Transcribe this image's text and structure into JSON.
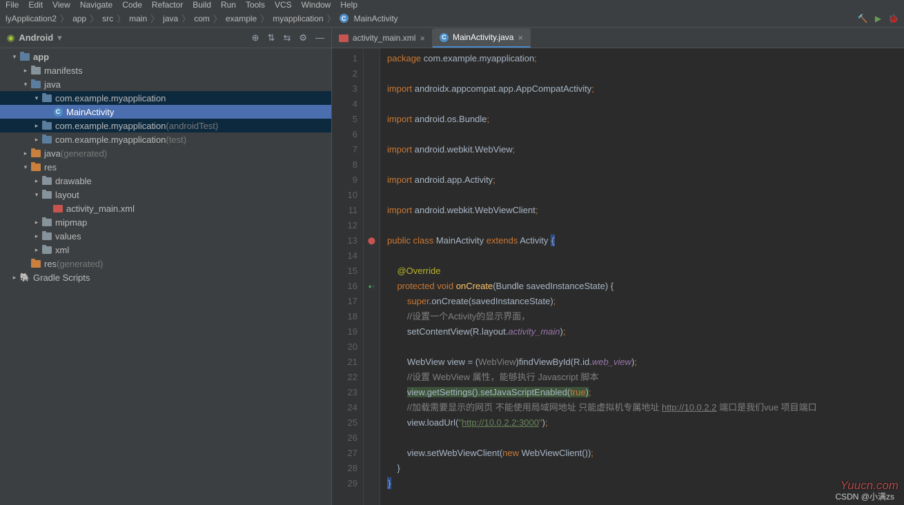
{
  "menubar": [
    "File",
    "Edit",
    "View",
    "Navigate",
    "Code",
    "Refactor",
    "Build",
    "Run",
    "Tools",
    "VCS",
    "Window",
    "Help"
  ],
  "breadcrumb": [
    "lyApplication2",
    "app",
    "src",
    "main",
    "java",
    "com",
    "example",
    "myapplication",
    "MainActivity"
  ],
  "sidebar": {
    "title": "Android",
    "tree": [
      {
        "indent": 0,
        "chev": "▾",
        "icon": "folder-blue",
        "label": "app",
        "bold": true
      },
      {
        "indent": 1,
        "chev": "▸",
        "icon": "folder",
        "label": "manifests"
      },
      {
        "indent": 1,
        "chev": "▾",
        "icon": "folder-blue",
        "label": "java"
      },
      {
        "indent": 2,
        "chev": "▾",
        "icon": "folder-blue",
        "label": "com.example.myapplication",
        "sel": "band"
      },
      {
        "indent": 3,
        "chev": "",
        "icon": "class",
        "label": "MainActivity",
        "sel": "full"
      },
      {
        "indent": 2,
        "chev": "▸",
        "icon": "folder-blue",
        "label": "com.example.myapplication",
        "suffix": "(androidTest)",
        "sel": "band"
      },
      {
        "indent": 2,
        "chev": "▸",
        "icon": "folder-blue",
        "label": "com.example.myapplication",
        "suffix": "(test)"
      },
      {
        "indent": 1,
        "chev": "▸",
        "icon": "folder-orange",
        "label": "java",
        "suffix": "(generated)"
      },
      {
        "indent": 1,
        "chev": "▾",
        "icon": "folder-orange",
        "label": "res"
      },
      {
        "indent": 2,
        "chev": "▸",
        "icon": "folder",
        "label": "drawable"
      },
      {
        "indent": 2,
        "chev": "▾",
        "icon": "folder",
        "label": "layout"
      },
      {
        "indent": 3,
        "chev": "",
        "icon": "xml",
        "label": "activity_main.xml"
      },
      {
        "indent": 2,
        "chev": "▸",
        "icon": "folder",
        "label": "mipmap"
      },
      {
        "indent": 2,
        "chev": "▸",
        "icon": "folder",
        "label": "values"
      },
      {
        "indent": 2,
        "chev": "▸",
        "icon": "folder",
        "label": "xml"
      },
      {
        "indent": 1,
        "chev": "",
        "icon": "folder-orange",
        "label": "res",
        "suffix": "(generated)"
      },
      {
        "indent": 0,
        "chev": "▸",
        "icon": "gradle",
        "label": "Gradle Scripts"
      }
    ]
  },
  "tabs": [
    {
      "icon": "xml",
      "label": "activity_main.xml",
      "active": false
    },
    {
      "icon": "class",
      "label": "MainActivity.java",
      "active": true
    }
  ],
  "code": {
    "lines": [
      [
        {
          "t": "package ",
          "c": "kw"
        },
        {
          "t": "com.example.myapplication",
          "c": "cls"
        },
        {
          "t": ";",
          "c": "lit"
        }
      ],
      [],
      [
        {
          "t": "import ",
          "c": "kw"
        },
        {
          "t": "androidx.appcompat.app.AppCompatActivity",
          "c": "cls"
        },
        {
          "t": ";",
          "c": "lit"
        }
      ],
      [],
      [
        {
          "t": "import ",
          "c": "kw"
        },
        {
          "t": "android.os.Bundle",
          "c": "cls"
        },
        {
          "t": ";",
          "c": "lit"
        }
      ],
      [],
      [
        {
          "t": "import ",
          "c": "kw"
        },
        {
          "t": "android.webkit.WebView",
          "c": "cls"
        },
        {
          "t": ";",
          "c": "lit"
        }
      ],
      [],
      [
        {
          "t": "import ",
          "c": "kw"
        },
        {
          "t": "android.app.Activity",
          "c": "cls"
        },
        {
          "t": ";",
          "c": "lit"
        }
      ],
      [],
      [
        {
          "t": "import ",
          "c": "kw"
        },
        {
          "t": "android.webkit.WebViewClient",
          "c": "cls"
        },
        {
          "t": ";",
          "c": "lit"
        }
      ],
      [],
      [
        {
          "t": "public class ",
          "c": "kw"
        },
        {
          "t": "MainActivity ",
          "c": "cls"
        },
        {
          "t": "extends ",
          "c": "kw"
        },
        {
          "t": "Activity ",
          "c": "cls"
        },
        {
          "t": "{",
          "c": "hlb"
        }
      ],
      [],
      [
        {
          "t": "    "
        },
        {
          "t": "@Override",
          "c": "ann"
        }
      ],
      [
        {
          "t": "    "
        },
        {
          "t": "protected void ",
          "c": "kw"
        },
        {
          "t": "onCreate",
          "c": "fn"
        },
        {
          "t": "(Bundle savedInstanceState) {",
          "c": "cls"
        }
      ],
      [
        {
          "t": "        "
        },
        {
          "t": "super",
          "c": "kw"
        },
        {
          "t": ".onCreate(savedInstanceState)",
          "c": "cls"
        },
        {
          "t": ";",
          "c": "lit"
        }
      ],
      [
        {
          "t": "        "
        },
        {
          "t": "//设置一个Activity的显示界面，",
          "c": "com"
        }
      ],
      [
        {
          "t": "        "
        },
        {
          "t": "setContentView(R.layout.",
          "c": "cls"
        },
        {
          "t": "activity_main",
          "c": "fld i"
        },
        {
          "t": ")",
          "c": "cls"
        },
        {
          "t": ";",
          "c": "lit"
        }
      ],
      [],
      [
        {
          "t": "        "
        },
        {
          "t": "WebView view = (",
          "c": "cls"
        },
        {
          "t": "WebView",
          "c": "com"
        },
        {
          "t": ")findViewById(R.id.",
          "c": "cls"
        },
        {
          "t": "web_view",
          "c": "fld i"
        },
        {
          "t": ")",
          "c": "cls"
        },
        {
          "t": ";",
          "c": "lit"
        }
      ],
      [
        {
          "t": "        "
        },
        {
          "t": "//设置 WebView 属性，能够执行 Javascript 脚本",
          "c": "com"
        }
      ],
      [
        {
          "t": "        "
        },
        {
          "t": "view.getSettings().setJavaScriptEnabled(",
          "c": "cls",
          "hl": "g"
        },
        {
          "t": "true",
          "c": "kw",
          "hl": "g"
        },
        {
          "t": ")",
          "c": "cls",
          "hl": "g"
        },
        {
          "t": ";",
          "c": "lit"
        }
      ],
      [
        {
          "t": "        "
        },
        {
          "t": "//加载需要显示的网页 不能使用局域网地址 只能虚拟机专属地址 ",
          "c": "com"
        },
        {
          "t": "http://10.0.2.2",
          "c": "com",
          "u": true
        },
        {
          "t": " 端口是我们vue 项目端口",
          "c": "com"
        }
      ],
      [
        {
          "t": "        "
        },
        {
          "t": "view.loadUrl(",
          "c": "cls"
        },
        {
          "t": "\"",
          "c": "str"
        },
        {
          "t": "http://10.0.2.2:3000",
          "c": "str u"
        },
        {
          "t": "\"",
          "c": "str"
        },
        {
          "t": ")",
          "c": "cls"
        },
        {
          "t": ";",
          "c": "lit"
        }
      ],
      [],
      [
        {
          "t": "        "
        },
        {
          "t": "view.setWebViewClient(",
          "c": "cls"
        },
        {
          "t": "new ",
          "c": "kw"
        },
        {
          "t": "WebViewClient())",
          "c": "cls"
        },
        {
          "t": ";",
          "c": "lit"
        }
      ],
      [
        {
          "t": "    }",
          "c": "cls"
        }
      ],
      [
        {
          "t": "}",
          "c": "hlb"
        }
      ]
    ]
  },
  "watermark": "Yuucn.com",
  "csdn": "CSDN @小满zs"
}
